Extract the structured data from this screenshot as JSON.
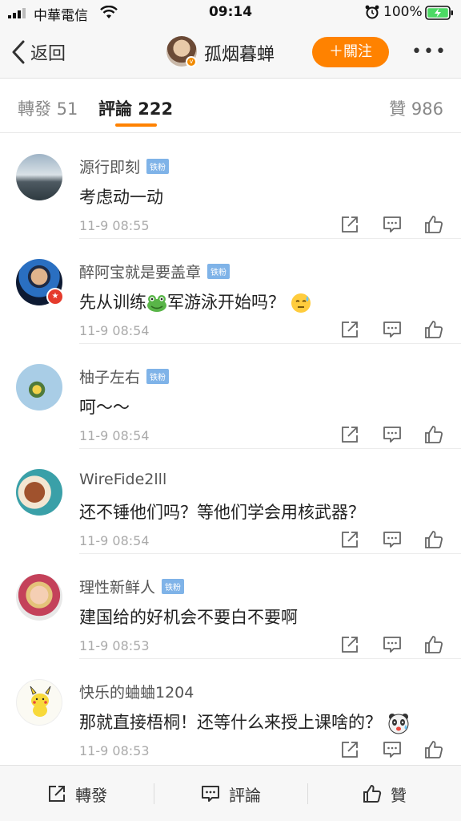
{
  "status_bar": {
    "carrier": "中華電信",
    "time": "09:14",
    "battery": "100%"
  },
  "nav": {
    "back_label": "返回",
    "title": "孤烟暮蝉",
    "follow_label": "＋關注",
    "more_label": "•••"
  },
  "tabs": {
    "repost": "轉發 51",
    "comments": "評論 222",
    "likes": "贊 986"
  },
  "comments": [
    {
      "name": "源行即刻",
      "badge": "铁粉",
      "text": "考虑动一动",
      "time": "11-9 08:55"
    },
    {
      "name": "醉阿宝就是要盖章",
      "badge": "铁粉",
      "text_before": "先从训练",
      "text_after": "军游泳开始吗？",
      "time": "11-9 08:54"
    },
    {
      "name": "柚子左右",
      "badge": "铁粉",
      "text": "呵～～",
      "time": "11-9 08:54"
    },
    {
      "name": "WireFide2lll",
      "badge": "",
      "text": "还不锤他们吗？等他们学会用核武器？",
      "time": "11-9 08:54"
    },
    {
      "name": "理性新鲜人",
      "badge": "铁粉",
      "text": "建国给的好机会不要白不要啊",
      "time": "11-9 08:53"
    },
    {
      "name": "快乐的蛐蛐1204",
      "badge": "",
      "text": "那就直接梧桐！还等什么来授上课啥的？",
      "time": "11-9 08:53"
    }
  ],
  "toolbar": {
    "repost": "轉發",
    "comment": "評論",
    "like": "贊"
  },
  "colors": {
    "accent": "#ff8200",
    "fan_badge": "#7fb3e8",
    "verified_badge": "#e53b2c"
  }
}
